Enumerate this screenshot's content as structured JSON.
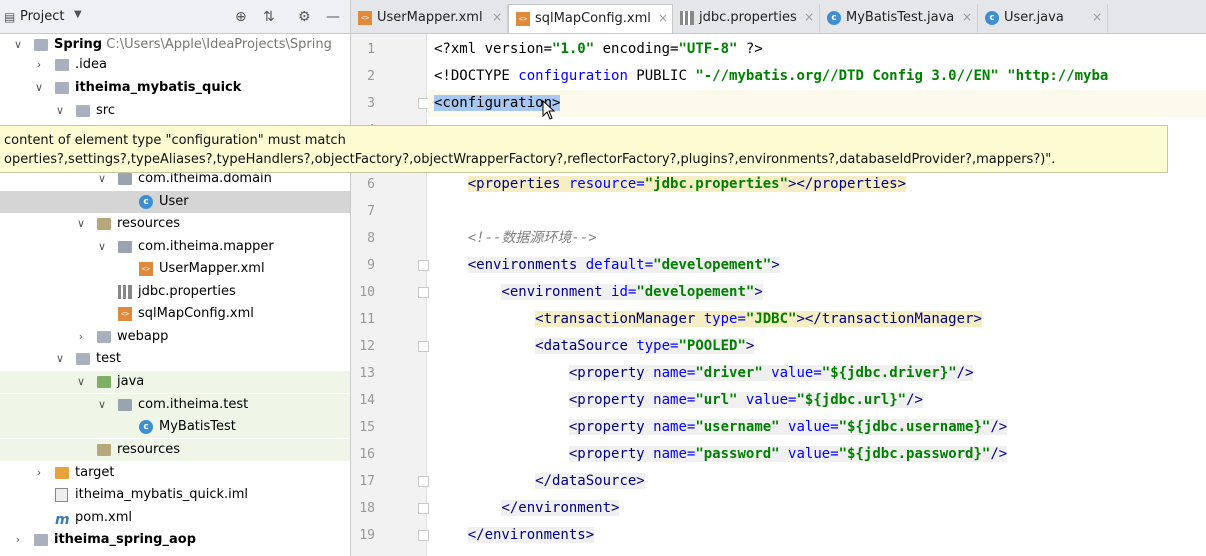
{
  "project_panel": {
    "title": "Project",
    "tree": [
      {
        "label": "Spring",
        "path": "C:\\Users\\Apple\\IdeaProjects\\Spring",
        "bold": true,
        "arrow": "down",
        "icon": "module-folder"
      },
      {
        "label": ".idea",
        "arrow": "right",
        "icon": "folder"
      },
      {
        "label": "itheima_mybatis_quick",
        "bold": true,
        "arrow": "down",
        "icon": "module-folder"
      },
      {
        "label": "src",
        "arrow": "down",
        "icon": "folder"
      },
      {
        "label": "com.itheima.domain",
        "arrow": "down",
        "icon": "package"
      },
      {
        "label": "User",
        "icon": "class"
      },
      {
        "label": "resources",
        "arrow": "down",
        "icon": "resources-folder"
      },
      {
        "label": "com.itheima.mapper",
        "arrow": "down",
        "icon": "package"
      },
      {
        "label": "UserMapper.xml",
        "icon": "xml-file"
      },
      {
        "label": "jdbc.properties",
        "icon": "properties-file"
      },
      {
        "label": "sqlMapConfig.xml",
        "icon": "xml-file"
      },
      {
        "label": "webapp",
        "arrow": "right",
        "icon": "folder"
      },
      {
        "label": "test",
        "arrow": "down",
        "icon": "folder"
      },
      {
        "label": "java",
        "arrow": "down",
        "icon": "test-sources-folder"
      },
      {
        "label": "com.itheima.test",
        "arrow": "down",
        "icon": "package"
      },
      {
        "label": "MyBatisTest",
        "icon": "class"
      },
      {
        "label": "resources",
        "icon": "resources-folder"
      },
      {
        "label": "target",
        "arrow": "right",
        "icon": "excluded-folder"
      },
      {
        "label": "itheima_mybatis_quick.iml",
        "icon": "iml-file"
      },
      {
        "label": "pom.xml",
        "icon": "maven-file"
      },
      {
        "label": "itheima_spring_aop",
        "bold": true,
        "arrow": "right",
        "icon": "module-folder"
      }
    ]
  },
  "tabs": [
    {
      "label": "UserMapper.xml",
      "icon": "xml-file"
    },
    {
      "label": "sqlMapConfig.xml",
      "icon": "xml-file",
      "active": true
    },
    {
      "label": "jdbc.properties",
      "icon": "properties-file"
    },
    {
      "label": "MyBatisTest.java",
      "icon": "class"
    },
    {
      "label": "User.java",
      "icon": "class"
    }
  ],
  "tooltip": {
    "line1": "content of element type \"configuration\" must match",
    "line2": "operties?,settings?,typeAliases?,typeHandlers?,objectFactory?,objectWrapperFactory?,reflectorFactory?,plugins?,environments?,databaseIdProvider?,mappers?)\"."
  },
  "code_lines": [
    {
      "n": "1",
      "tokens": [
        {
          "t": "<?xml version=",
          "c": "pi"
        },
        {
          "t": "\"1.0\"",
          "c": "val"
        },
        {
          "t": " encoding=",
          "c": "pi"
        },
        {
          "t": "\"UTF-8\"",
          "c": "val"
        },
        {
          "t": " ?>",
          "c": "pi"
        }
      ]
    },
    {
      "n": "2",
      "tokens": [
        {
          "t": "<!DOCTYPE ",
          "c": "pi"
        },
        {
          "t": "configuration",
          "c": "attr"
        },
        {
          "t": " PUBLIC ",
          "c": "pi"
        },
        {
          "t": "\"-//mybatis.org//DTD Config 3.0//EN\"",
          "c": "val"
        },
        {
          "t": " ",
          "c": "pi"
        },
        {
          "t": "\"http://myba",
          "c": "val"
        }
      ]
    },
    {
      "n": "3",
      "tokens": [
        {
          "t": "<configuration>",
          "c": "sel"
        }
      ]
    },
    {
      "n": "4",
      "tokens": []
    },
    {
      "n": "5",
      "tokens": []
    },
    {
      "n": "6",
      "tokens": [
        {
          "t": "    "
        },
        {
          "t": "<properties ",
          "c": "tag",
          "bg": "tagbg"
        },
        {
          "t": "resource=",
          "c": "attr",
          "bg": "tagbg"
        },
        {
          "t": "\"jdbc.properties\"",
          "c": "val",
          "bg": "tagbg"
        },
        {
          "t": "></properties>",
          "c": "tag",
          "bg": "tagbg"
        }
      ]
    },
    {
      "n": "7",
      "tokens": []
    },
    {
      "n": "8",
      "tokens": [
        {
          "t": "    "
        },
        {
          "t": "<!--数据源环境-->",
          "c": "comment"
        }
      ]
    },
    {
      "n": "9",
      "tokens": [
        {
          "t": "    "
        },
        {
          "t": "<environments ",
          "c": "tag",
          "bg": "tagbg2"
        },
        {
          "t": "default=",
          "c": "attr",
          "bg": "tagbg2"
        },
        {
          "t": "\"developement\"",
          "c": "val",
          "bg": "tagbg2"
        },
        {
          "t": ">",
          "c": "tag",
          "bg": "tagbg2"
        }
      ]
    },
    {
      "n": "10",
      "tokens": [
        {
          "t": "        "
        },
        {
          "t": "<environment ",
          "c": "tag",
          "bg": "tagbg2"
        },
        {
          "t": "id=",
          "c": "attr",
          "bg": "tagbg2"
        },
        {
          "t": "\"developement\"",
          "c": "val",
          "bg": "tagbg2"
        },
        {
          "t": ">",
          "c": "tag",
          "bg": "tagbg2"
        }
      ]
    },
    {
      "n": "11",
      "tokens": [
        {
          "t": "            "
        },
        {
          "t": "<transactionManager ",
          "c": "tag",
          "bg": "tagbg"
        },
        {
          "t": "type=",
          "c": "attr",
          "bg": "tagbg"
        },
        {
          "t": "\"JDBC\"",
          "c": "val",
          "bg": "tagbg"
        },
        {
          "t": "></transactionManager>",
          "c": "tag",
          "bg": "tagbg"
        }
      ]
    },
    {
      "n": "12",
      "tokens": [
        {
          "t": "            "
        },
        {
          "t": "<dataSource ",
          "c": "tag",
          "bg": "tagbg2"
        },
        {
          "t": "type=",
          "c": "attr",
          "bg": "tagbg2"
        },
        {
          "t": "\"POOLED\"",
          "c": "val",
          "bg": "tagbg2"
        },
        {
          "t": ">",
          "c": "tag",
          "bg": "tagbg2"
        }
      ]
    },
    {
      "n": "13",
      "tokens": [
        {
          "t": "                "
        },
        {
          "t": "<property ",
          "c": "tag",
          "bg": "tagbg2"
        },
        {
          "t": "name=",
          "c": "attr",
          "bg": "tagbg2"
        },
        {
          "t": "\"driver\"",
          "c": "val",
          "bg": "tagbg2"
        },
        {
          "t": " value=",
          "c": "attr",
          "bg": "tagbg2"
        },
        {
          "t": "\"${jdbc.driver}\"",
          "c": "val",
          "bg": "tagbg2"
        },
        {
          "t": "/>",
          "c": "tag",
          "bg": "tagbg2"
        }
      ]
    },
    {
      "n": "14",
      "tokens": [
        {
          "t": "                "
        },
        {
          "t": "<property ",
          "c": "tag",
          "bg": "tagbg2"
        },
        {
          "t": "name=",
          "c": "attr",
          "bg": "tagbg2"
        },
        {
          "t": "\"url\"",
          "c": "val",
          "bg": "tagbg2"
        },
        {
          "t": " value=",
          "c": "attr",
          "bg": "tagbg2"
        },
        {
          "t": "\"${jdbc.url}\"",
          "c": "val",
          "bg": "tagbg2"
        },
        {
          "t": "/>",
          "c": "tag",
          "bg": "tagbg2"
        }
      ]
    },
    {
      "n": "15",
      "tokens": [
        {
          "t": "                "
        },
        {
          "t": "<property ",
          "c": "tag",
          "bg": "tagbg2"
        },
        {
          "t": "name=",
          "c": "attr",
          "bg": "tagbg2"
        },
        {
          "t": "\"username\"",
          "c": "val",
          "bg": "tagbg2"
        },
        {
          "t": " value=",
          "c": "attr",
          "bg": "tagbg2"
        },
        {
          "t": "\"${jdbc.username}\"",
          "c": "val",
          "bg": "tagbg2"
        },
        {
          "t": "/>",
          "c": "tag",
          "bg": "tagbg2"
        }
      ]
    },
    {
      "n": "16",
      "tokens": [
        {
          "t": "                "
        },
        {
          "t": "<property ",
          "c": "tag",
          "bg": "tagbg2"
        },
        {
          "t": "name=",
          "c": "attr",
          "bg": "tagbg2"
        },
        {
          "t": "\"password\"",
          "c": "val",
          "bg": "tagbg2"
        },
        {
          "t": " value=",
          "c": "attr",
          "bg": "tagbg2"
        },
        {
          "t": "\"${jdbc.password}\"",
          "c": "val",
          "bg": "tagbg2"
        },
        {
          "t": "/>",
          "c": "tag",
          "bg": "tagbg2"
        }
      ]
    },
    {
      "n": "17",
      "tokens": [
        {
          "t": "            "
        },
        {
          "t": "</dataSource>",
          "c": "tag",
          "bg": "tagbg2"
        }
      ]
    },
    {
      "n": "18",
      "tokens": [
        {
          "t": "        "
        },
        {
          "t": "</environment>",
          "c": "tag",
          "bg": "tagbg2"
        }
      ]
    },
    {
      "n": "19",
      "tokens": [
        {
          "t": "    "
        },
        {
          "t": "</environments>",
          "c": "tag",
          "bg": "tagbg2"
        }
      ]
    }
  ]
}
